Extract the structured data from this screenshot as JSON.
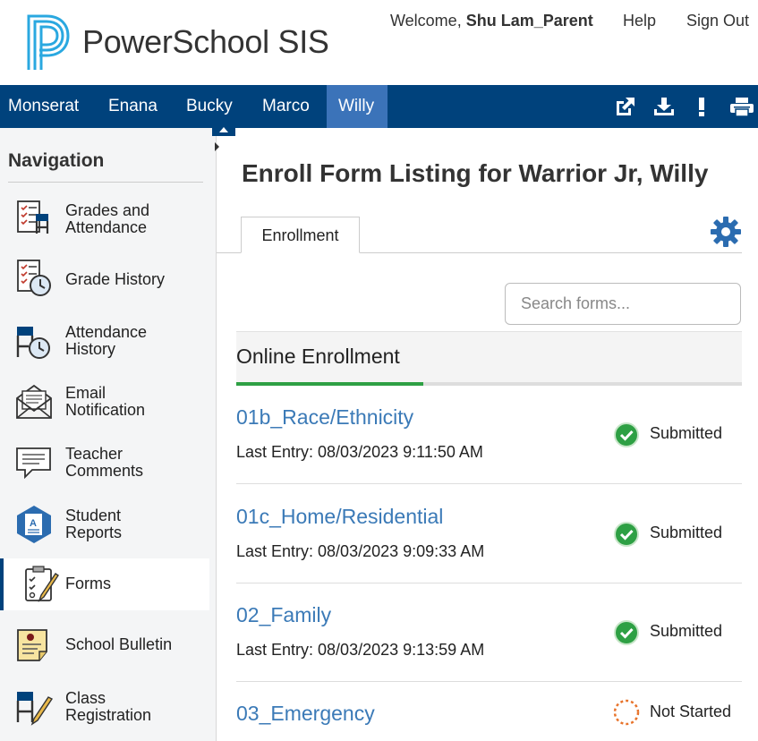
{
  "header": {
    "brand": "PowerSchool SIS",
    "welcome_prefix": "Welcome, ",
    "user_name": "Shu Lam_Parent",
    "help": "Help",
    "sign_out": "Sign Out"
  },
  "students": [
    "Monserat",
    "Enana",
    "Bucky",
    "Marco",
    "Willy"
  ],
  "active_student": "Willy",
  "toolbar_icons": [
    "external-link-icon",
    "download-icon",
    "alert-icon",
    "print-icon"
  ],
  "navigation": {
    "title": "Navigation",
    "items": [
      {
        "label_1": "Grades and",
        "label_2": "Attendance",
        "icon": "grades-attendance-icon"
      },
      {
        "label_1": "Grade History",
        "label_2": "",
        "icon": "grade-history-icon"
      },
      {
        "label_1": "Attendance",
        "label_2": "History",
        "icon": "attendance-history-icon"
      },
      {
        "label_1": "Email",
        "label_2": "Notification",
        "icon": "email-icon"
      },
      {
        "label_1": "Teacher",
        "label_2": "Comments",
        "icon": "comments-icon"
      },
      {
        "label_1": "Student",
        "label_2": "Reports",
        "icon": "reports-icon"
      },
      {
        "label_1": "Forms",
        "label_2": "",
        "icon": "forms-icon"
      },
      {
        "label_1": "School Bulletin",
        "label_2": "",
        "icon": "bulletin-icon"
      },
      {
        "label_1": "Class",
        "label_2": "Registration",
        "icon": "class-registration-icon"
      }
    ],
    "active_item": "Forms"
  },
  "main": {
    "title": "Enroll Form Listing for Warrior Jr, Willy",
    "tab": "Enrollment",
    "search_placeholder": "Search forms...",
    "section_title": "Online Enrollment",
    "section_progress": 0.37,
    "forms": [
      {
        "name": "01b_Race/Ethnicity",
        "entry": "Last Entry: 08/03/2023 9:11:50 AM",
        "status": "Submitted"
      },
      {
        "name": "01c_Home/Residential",
        "entry": "Last Entry: 08/03/2023 9:09:33 AM",
        "status": "Submitted"
      },
      {
        "name": "02_Family",
        "entry": "Last Entry: 08/03/2023 9:13:59 AM",
        "status": "Submitted"
      },
      {
        "name": "03_Emergency",
        "entry": "",
        "status": "Not Started"
      }
    ]
  },
  "colors": {
    "brand_blue": "#00427c",
    "active_tab": "#3b73b9",
    "link": "#3b7ab7",
    "submitted": "#2ea044",
    "not_started": "#e8742c"
  }
}
